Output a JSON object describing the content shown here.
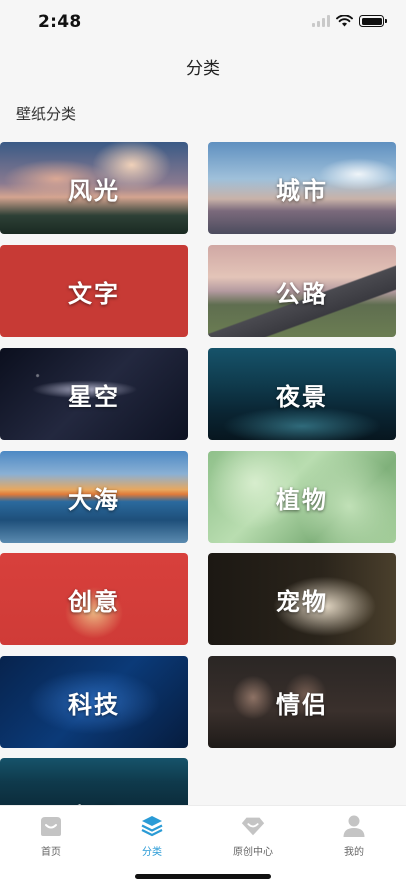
{
  "status": {
    "time": "2:48"
  },
  "nav": {
    "title": "分类"
  },
  "section": {
    "heading": "壁纸分类"
  },
  "categories": [
    {
      "label": "风光",
      "bg": "fengguang"
    },
    {
      "label": "城市",
      "bg": "chengshi"
    },
    {
      "label": "文字",
      "bg": "wenzi"
    },
    {
      "label": "公路",
      "bg": "gonglu"
    },
    {
      "label": "星空",
      "bg": "xingkong"
    },
    {
      "label": "夜景",
      "bg": "yejing"
    },
    {
      "label": "大海",
      "bg": "dahai"
    },
    {
      "label": "植物",
      "bg": "zhiwu"
    },
    {
      "label": "创意",
      "bg": "chuangyi"
    },
    {
      "label": "宠物",
      "bg": "chongwu"
    },
    {
      "label": "科技",
      "bg": "keji"
    },
    {
      "label": "情侣",
      "bg": "qinglv"
    },
    {
      "label": "夜景",
      "bg": "yejing2"
    }
  ],
  "tabbar": {
    "home": "首页",
    "category": "分类",
    "original": "原创中心",
    "mine": "我的",
    "active_color": "#2a9bd6",
    "inactive_color": "#c4c4c4"
  }
}
